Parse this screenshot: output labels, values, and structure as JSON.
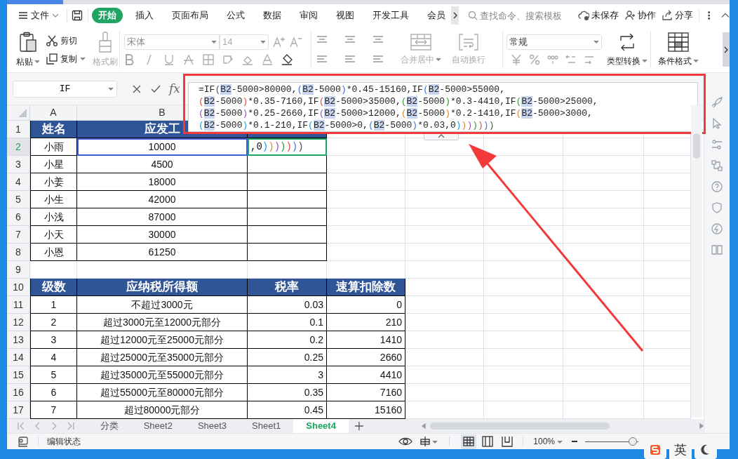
{
  "menu": {
    "file_label": "文件",
    "tabs": [
      {
        "label": "开始",
        "selected": true
      },
      {
        "label": "插入",
        "selected": false
      },
      {
        "label": "页面布局",
        "selected": false
      },
      {
        "label": "公式",
        "selected": false
      },
      {
        "label": "数据",
        "selected": false
      },
      {
        "label": "审阅",
        "selected": false
      },
      {
        "label": "视图",
        "selected": false
      },
      {
        "label": "开发工具",
        "selected": false
      },
      {
        "label": "会员",
        "selected": false
      }
    ],
    "search": {
      "placeholder": "查找命令、搜索模板"
    },
    "actions": [
      {
        "label": "未保存",
        "kind": "cloud"
      },
      {
        "label": "协作",
        "kind": "user"
      },
      {
        "label": "分享",
        "kind": "share"
      }
    ]
  },
  "ribbon": {
    "clipboard": [
      {
        "label": "粘贴",
        "kind": "paste",
        "disabled": false,
        "dropdown": true
      },
      {
        "label": "剪切",
        "kind": "cut",
        "disabled": false,
        "dropdown": false
      },
      {
        "label": "复制",
        "kind": "copy",
        "disabled": false,
        "dropdown": true
      },
      {
        "label": "格式刷",
        "kind": "brush",
        "disabled": true,
        "dropdown": false
      }
    ],
    "font_family": "宋体",
    "font_size": "14",
    "alignment": [
      {
        "label": "合并居中",
        "kind": "merge",
        "disabled": true,
        "dropdown": true
      },
      {
        "label": "自动换行",
        "kind": "wrap",
        "disabled": true,
        "dropdown": false
      }
    ],
    "number_format": "常规",
    "number": [
      {
        "label": "类型转换",
        "kind": "convert",
        "disabled": false,
        "dropdown": true
      },
      {
        "label": "条件格式",
        "kind": "conditional",
        "disabled": false,
        "dropdown": true
      }
    ]
  },
  "formula_bar": {
    "name_box": "IF",
    "function_label": "fx",
    "formula_lines": [
      "=IF(B2-5000>80000,(B2-5000)*0.45-15160,IF(B2-5000>55000,",
      "(B2-5000)*0.35-7160,IF(B2-5000>35000,(B2-5000)*0.3-4410,IF(B2-5000>25000,",
      "(B2-5000)*0.25-2660,IF(B2-5000>12000,(B2-5000)*0.2-1410,IF(B2-5000>3000,",
      "(B2-5000)*0.1-210,IF(B2-5000>0,(B2-5000)*0.03,0)))))))"
    ]
  },
  "sheet": {
    "column_headers": [
      "A",
      "B"
    ],
    "rows": [
      {
        "number": "1",
        "selected": false,
        "cells": [
          {
            "kind": "header",
            "text": "姓名"
          },
          {
            "kind": "header",
            "text": "应发工"
          },
          {
            "kind": "header"
          }
        ]
      },
      {
        "number": "2",
        "selected": true,
        "cells": [
          {
            "kind": "data",
            "text": "小雨"
          },
          {
            "kind": "data",
            "text": "10000",
            "referenced": true
          },
          {
            "kind": "data",
            "text": ",0)))))))",
            "active": true
          }
        ]
      },
      {
        "number": "3",
        "selected": false,
        "cells": [
          {
            "kind": "data",
            "text": "小星"
          },
          {
            "kind": "data",
            "text": "4500"
          },
          {
            "kind": "data"
          }
        ]
      },
      {
        "number": "4",
        "selected": false,
        "cells": [
          {
            "kind": "data",
            "text": "小姜"
          },
          {
            "kind": "data",
            "text": "18000"
          },
          {
            "kind": "data"
          }
        ]
      },
      {
        "number": "5",
        "selected": false,
        "cells": [
          {
            "kind": "data",
            "text": "小生"
          },
          {
            "kind": "data",
            "text": "42000"
          },
          {
            "kind": "data"
          }
        ]
      },
      {
        "number": "6",
        "selected": false,
        "cells": [
          {
            "kind": "data",
            "text": "小浅"
          },
          {
            "kind": "data",
            "text": "87000"
          },
          {
            "kind": "data"
          }
        ]
      },
      {
        "number": "7",
        "selected": false,
        "cells": [
          {
            "kind": "data",
            "text": "小天"
          },
          {
            "kind": "data",
            "text": "30000"
          },
          {
            "kind": "data"
          }
        ]
      },
      {
        "number": "8",
        "selected": false,
        "cells": [
          {
            "kind": "data",
            "text": "小恩"
          },
          {
            "kind": "data",
            "text": "61250"
          },
          {
            "kind": "data"
          }
        ]
      },
      {
        "number": "9",
        "selected": false,
        "cells": []
      },
      {
        "number": "10",
        "selected": false,
        "cells": [
          {
            "kind": "header",
            "text": "级数"
          },
          {
            "kind": "header",
            "text": "应纳税所得额"
          },
          {
            "kind": "header",
            "text": "税率"
          },
          {
            "kind": "header",
            "text": "速算扣除数"
          }
        ]
      },
      {
        "number": "11",
        "selected": false,
        "cells": [
          {
            "kind": "data",
            "text": "1"
          },
          {
            "kind": "data",
            "text": "不超过3000元"
          },
          {
            "kind": "num",
            "text": "0.03"
          },
          {
            "kind": "num",
            "text": "0"
          }
        ]
      },
      {
        "number": "12",
        "selected": false,
        "cells": [
          {
            "kind": "data",
            "text": "2"
          },
          {
            "kind": "data",
            "text": "超过3000元至12000元部分"
          },
          {
            "kind": "num",
            "text": "0.1"
          },
          {
            "kind": "num",
            "text": "210"
          }
        ]
      },
      {
        "number": "13",
        "selected": false,
        "cells": [
          {
            "kind": "data",
            "text": "3"
          },
          {
            "kind": "data",
            "text": "超过12000元至25000元部分"
          },
          {
            "kind": "num",
            "text": "0.2"
          },
          {
            "kind": "num",
            "text": "1410"
          }
        ]
      },
      {
        "number": "14",
        "selected": false,
        "cells": [
          {
            "kind": "data",
            "text": "4"
          },
          {
            "kind": "data",
            "text": "超过25000元至35000元部分"
          },
          {
            "kind": "num",
            "text": "0.25"
          },
          {
            "kind": "num",
            "text": "2660"
          }
        ]
      },
      {
        "number": "15",
        "selected": false,
        "cells": [
          {
            "kind": "data",
            "text": "5"
          },
          {
            "kind": "data",
            "text": "超过35000元至55000元部分"
          },
          {
            "kind": "num",
            "text": "3"
          },
          {
            "kind": "num",
            "text": "4410"
          }
        ]
      },
      {
        "number": "16",
        "selected": false,
        "cells": [
          {
            "kind": "data",
            "text": "6"
          },
          {
            "kind": "data",
            "text": "超过55000元至80000元部分"
          },
          {
            "kind": "num",
            "text": "0.35"
          },
          {
            "kind": "num",
            "text": "7160"
          }
        ]
      },
      {
        "number": "17",
        "selected": false,
        "cells": [
          {
            "kind": "data",
            "text": "7"
          },
          {
            "kind": "data",
            "text": "超过80000元部分"
          },
          {
            "kind": "num",
            "text": "0.45"
          },
          {
            "kind": "num",
            "text": "15160"
          }
        ]
      }
    ]
  },
  "sheet_tabs": [
    {
      "label": "分类",
      "selected": false
    },
    {
      "label": "Sheet2",
      "selected": false
    },
    {
      "label": "Sheet3",
      "selected": false
    },
    {
      "label": "Sheet1",
      "selected": false
    },
    {
      "label": "Sheet4",
      "selected": true
    }
  ],
  "status_bar": {
    "mode": "编辑状态",
    "zoom": "100%",
    "zoom_slider": {
      "level": 0.9
    }
  },
  "ime": {
    "language": "英"
  }
}
